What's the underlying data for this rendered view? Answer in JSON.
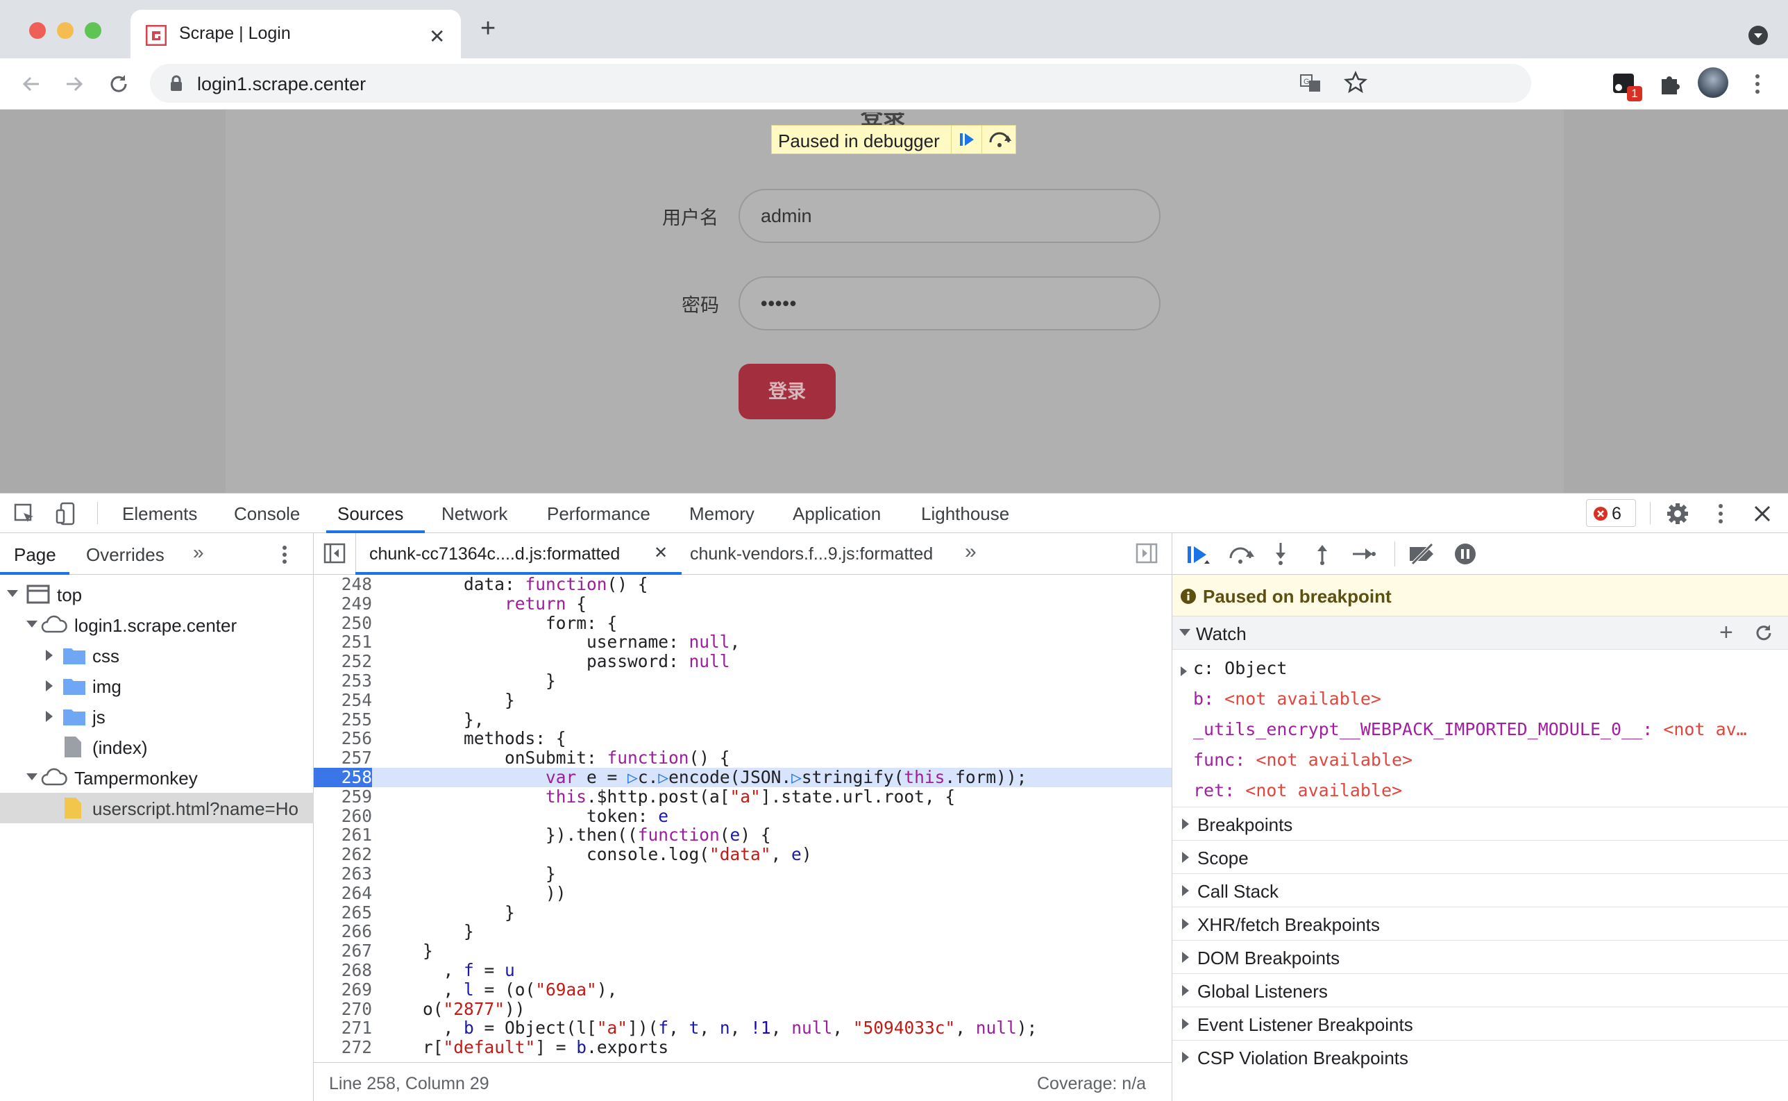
{
  "browser": {
    "tab_title": "Scrape | Login",
    "url": "login1.scrape.center",
    "extension_badge": "1"
  },
  "page": {
    "title_partial": "登录",
    "debugger_banner": "Paused in debugger",
    "username_label": "用户名",
    "username_value": "admin",
    "password_label": "密码",
    "password_value": "•••••",
    "login_button": "登录"
  },
  "devtools": {
    "tabs": [
      "Elements",
      "Console",
      "Sources",
      "Network",
      "Performance",
      "Memory",
      "Application",
      "Lighthouse"
    ],
    "active_tab": "Sources",
    "error_count": "6",
    "navigator_tabs": [
      "Page",
      "Overrides"
    ],
    "tree": {
      "top": "top",
      "origin": "login1.scrape.center",
      "folders": [
        "css",
        "img",
        "js"
      ],
      "index": "(index)",
      "tampermonkey": "Tampermonkey",
      "userscript": "userscript.html?name=Ho"
    },
    "editor_tabs": [
      "chunk-cc71364c....d.js:formatted",
      "chunk-vendors.f...9.js:formatted"
    ],
    "status_position": "Line 258, Column 29",
    "status_coverage": "Coverage: n/a",
    "paused_message": "Paused on breakpoint",
    "watch_header": "Watch",
    "watch": {
      "c_key": "c:",
      "c_val": "Object",
      "b_key": "b:",
      "b_val": "<not available>",
      "utils_key": "_utils_encrypt__WEBPACK_IMPORTED_MODULE_0__:",
      "utils_val": "<not av…",
      "func_key": "func:",
      "func_val": "<not available>",
      "ret_key": "ret:",
      "ret_val": "<not available>"
    },
    "sections": [
      "Breakpoints",
      "Scope",
      "Call Stack",
      "XHR/fetch Breakpoints",
      "DOM Breakpoints",
      "Global Listeners",
      "Event Listener Breakpoints",
      "CSP Violation Breakpoints"
    ]
  },
  "colors": {
    "accent": "#1a73e8",
    "login_button": "#a32e3e",
    "highlight_line": "#d7e4fb"
  }
}
